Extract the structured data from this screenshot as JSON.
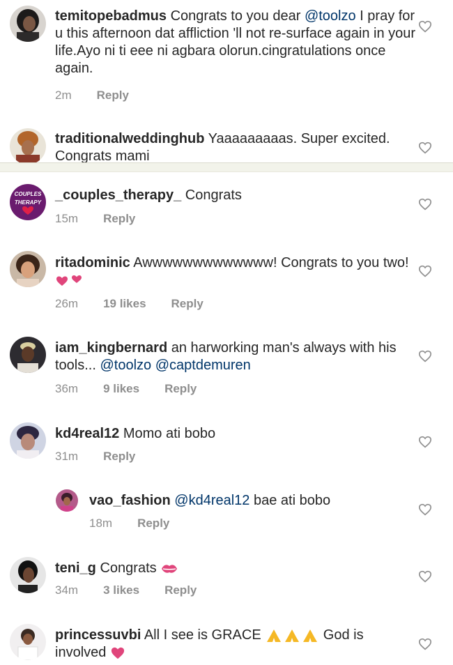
{
  "comments": [
    {
      "username": "temitopebadmus",
      "text_parts": [
        "Congrats to you dear ",
        "@toolzo",
        " I pray for u this afternoon dat affliction 'll not re-surface again in your life.Ayo ni ti eee ni agbara olorun.cingratulations once again."
      ],
      "time": "2m",
      "reply": "Reply"
    },
    {
      "username": "traditionalweddinghub",
      "text": "Yaaaaaaaaas.  Super excited. Congrats mami"
    },
    {
      "username": "_couples_therapy_",
      "text": "Congrats",
      "avatar_text_top": "COUPLES",
      "avatar_text_bottom": "THERAPY",
      "time": "15m",
      "reply": "Reply"
    },
    {
      "username": "ritadominic",
      "text": "Awwwwwwwwwwwww! Congrats to you two!",
      "time": "26m",
      "likes": "19 likes",
      "reply": "Reply"
    },
    {
      "username": "iam_kingbernard",
      "text": "an harworking man's always with his tools...",
      "mention1": "@toolzo",
      "mention2": "@captdemuren",
      "time": "36m",
      "likes": "9 likes",
      "reply": "Reply"
    },
    {
      "username": "kd4real12",
      "text": "Momo ati bobo",
      "time": "31m",
      "reply": "Reply"
    },
    {
      "username": "vao_fashion",
      "mention": "@kd4real12",
      "text": "bae ati bobo",
      "time": "18m",
      "reply": "Reply"
    },
    {
      "username": "teni_g",
      "text": "Congrats",
      "time": "34m",
      "likes": "3 likes",
      "reply": "Reply"
    },
    {
      "username": "princessuvbi",
      "text_a": "All I see is GRACE",
      "text_b": "God is involved"
    }
  ],
  "colors": {
    "mention": "#003569",
    "meta": "#8e8e8e",
    "heart_outline": "#8e8e8e",
    "divider": "#f2f3ea"
  },
  "icons": [
    "heart-outline-icon",
    "two-hearts-emoji",
    "kiss-mark-emoji",
    "praying-hands-emoji",
    "heart-emoji"
  ]
}
